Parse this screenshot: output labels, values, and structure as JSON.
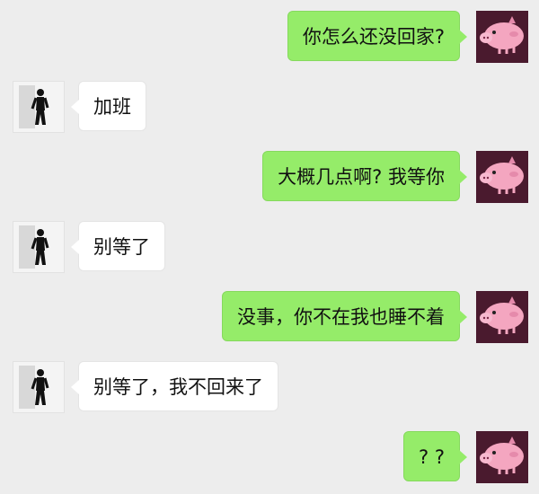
{
  "colors": {
    "background": "#ededed",
    "sent_bubble": "#95ec69",
    "received_bubble": "#ffffff",
    "pig_avatar_bg": "#4a1a2e",
    "pig_pink": "#f4a6c0"
  },
  "avatars": {
    "me": "pink-pig-icon",
    "contact": "person-photo-icon"
  },
  "messages": [
    {
      "side": "right",
      "text": "你怎么还没回家?"
    },
    {
      "side": "left",
      "text": "加班"
    },
    {
      "side": "right",
      "text": "大概几点啊? 我等你"
    },
    {
      "side": "left",
      "text": "别等了"
    },
    {
      "side": "right",
      "text": "没事，你不在我也睡不着"
    },
    {
      "side": "left",
      "text": "别等了，我不回来了"
    },
    {
      "side": "right",
      "text": "? ?"
    }
  ]
}
